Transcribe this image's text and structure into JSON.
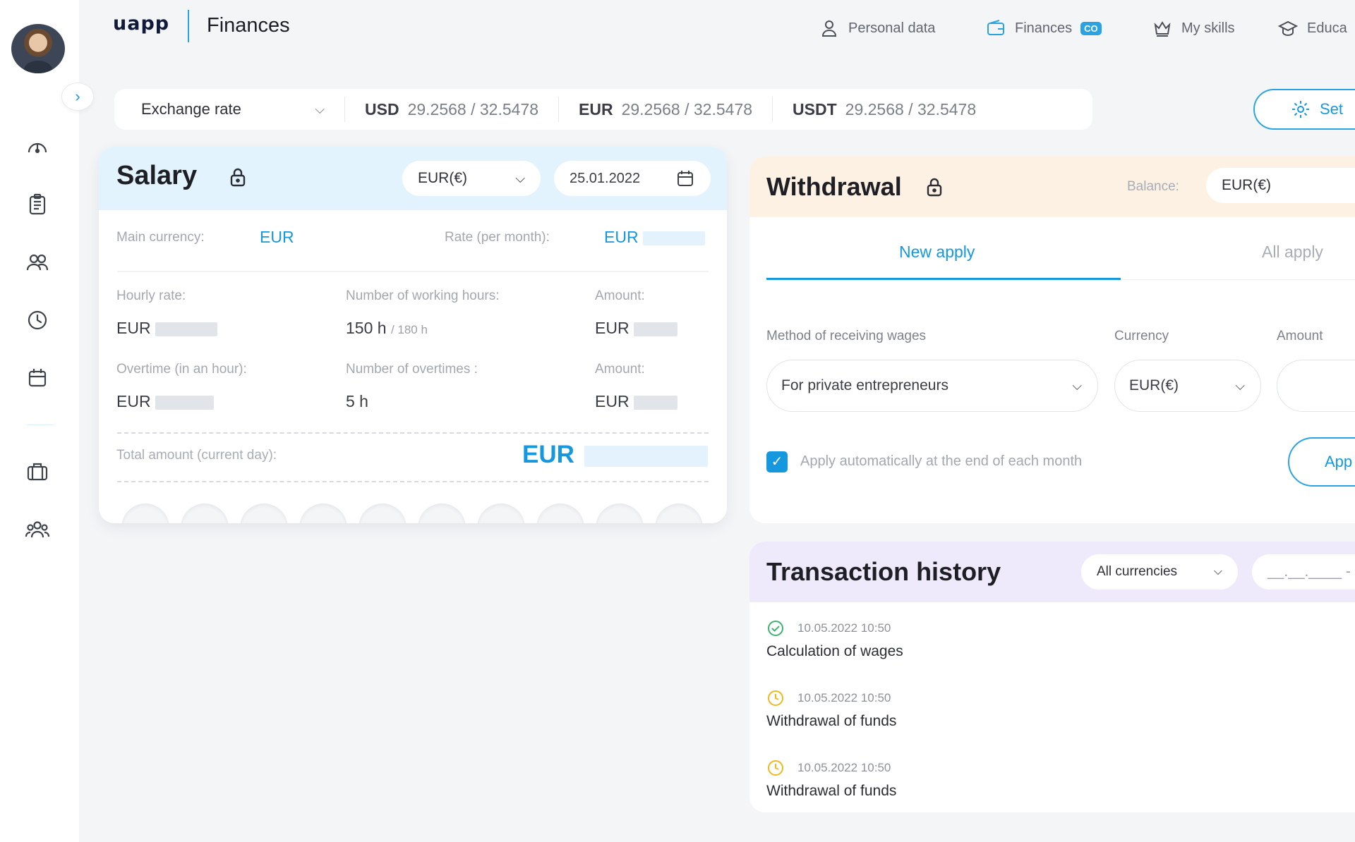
{
  "app": {
    "logo": "uapp",
    "title": "Finances"
  },
  "nav": [
    {
      "label": "Personal data",
      "icon": "user-icon"
    },
    {
      "label": "Finances",
      "icon": "wallet-icon",
      "badge": "CO"
    },
    {
      "label": "My skills",
      "icon": "crown-icon"
    },
    {
      "label": "Educa",
      "icon": "graduation-cap-icon"
    }
  ],
  "exchange": {
    "select_label": "Exchange rate",
    "pairs": [
      {
        "currency": "USD",
        "rate": "29.2568 / 32.5478"
      },
      {
        "currency": "EUR",
        "rate": "29.2568 / 32.5478"
      },
      {
        "currency": "USDT",
        "rate": "29.2568 / 32.5478"
      }
    ],
    "settings_label": "Set"
  },
  "salary": {
    "title": "Salary",
    "currency": "EUR(€)",
    "date": "25.01.2022",
    "main_currency_label": "Main currency:",
    "main_currency": "EUR",
    "rate_label": "Rate (per month):",
    "rate_currency": "EUR",
    "hourly_rate_label": "Hourly rate:",
    "hourly_rate_currency": "EUR",
    "working_hours_label": "Number of working hours:",
    "working_hours": "150 h",
    "working_hours_total": "/ 180 h",
    "amount_label": "Amount:",
    "amount_currency": "EUR",
    "overtime_label": "Overtime (in an hour):",
    "overtime_currency": "EUR",
    "overtimes_count_label": "Number of overtimes :",
    "overtimes_count": "5 h",
    "amount2_label": "Amount:",
    "amount2_currency": "EUR",
    "total_label": "Total amount (current day):",
    "total_currency": "EUR"
  },
  "withdrawal": {
    "title": "Withdrawal",
    "balance_label": "Balance:",
    "balance_currency": "EUR(€)",
    "tabs": [
      "New apply",
      "All apply"
    ],
    "method_label": "Method of receiving wages",
    "method_value": "For private entrepreneurs",
    "currency_label": "Currency",
    "currency_value": "EUR(€)",
    "amount_label": "Amount",
    "auto_apply_label": "Apply automatically at the end of each month",
    "auto_apply_checked": true,
    "apply_button": "App"
  },
  "history": {
    "title": "Transaction history",
    "filter": "All currencies",
    "date_range": "__.__.____ - ",
    "items": [
      {
        "datetime": "10.05.2022  10:50",
        "title": "Calculation of wages",
        "status": "completed",
        "icon": "check-circle-icon",
        "color": "#3cb371"
      },
      {
        "datetime": "10.05.2022  10:50",
        "title": "Withdrawal of funds",
        "status": "pending",
        "icon": "clock-icon",
        "color": "#f2b820"
      },
      {
        "datetime": "10.05.2022  10:50",
        "title": "Withdrawal of funds",
        "status": "pending",
        "icon": "clock-icon",
        "color": "#f2b820"
      }
    ]
  },
  "colors": {
    "accent": "#1598dd",
    "salary_head": "#e2f3fd",
    "withdraw_head": "#fdf1e4",
    "history_head": "#efe9fc"
  }
}
